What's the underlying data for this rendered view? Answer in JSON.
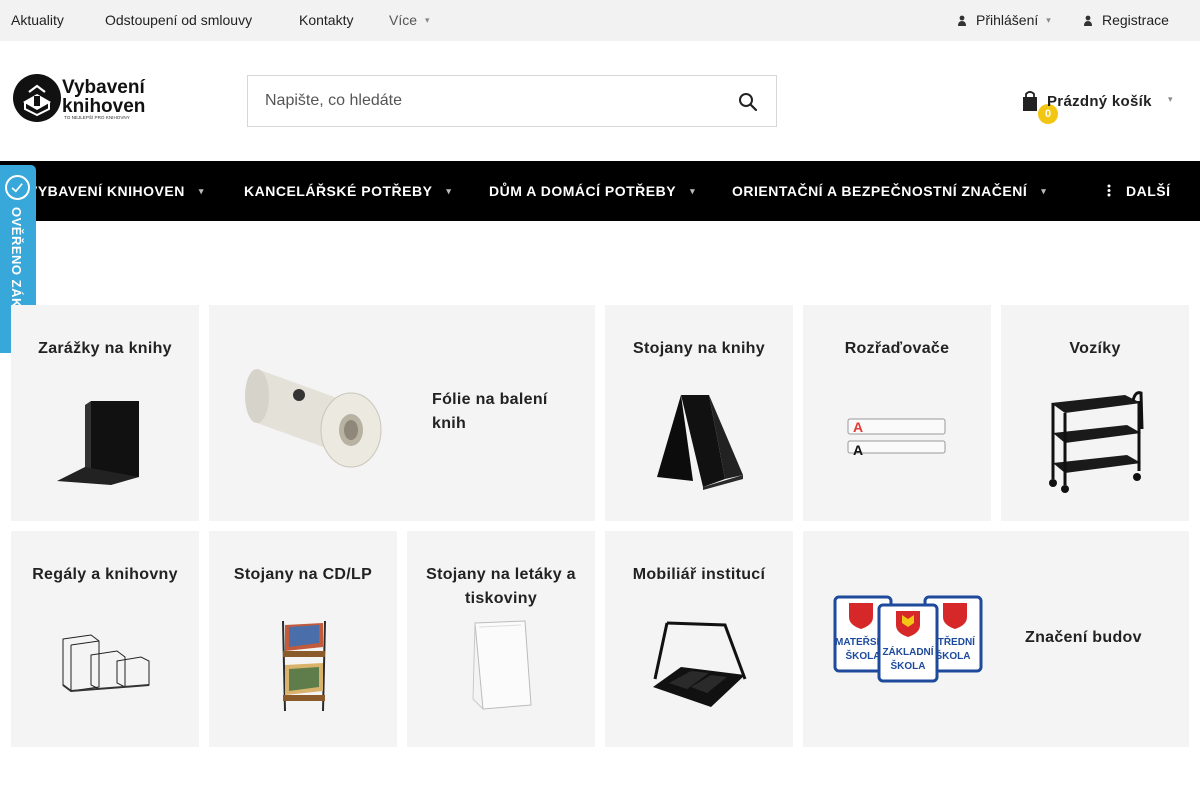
{
  "topbar": {
    "links": [
      "Aktuality",
      "Odstoupení od smlouvy",
      "Kontakty"
    ],
    "more": "Více",
    "login": "Přihlášení",
    "register": "Registrace"
  },
  "logo": {
    "line1": "Vybavení",
    "line2": "knihoven",
    "tagline": "TO NEJLEPŠÍ PRO KNIHOVNY"
  },
  "search": {
    "placeholder": "Napište, co hledáte"
  },
  "cart": {
    "count": "0",
    "label": "Prázdný košík"
  },
  "nav": {
    "items": [
      "VYBAVENÍ KNIHOVEN",
      "KANCELÁŘSKÉ POTŘEBY",
      "DŮM A DOMÁCÍ POTŘEBY",
      "ORIENTAČNÍ A BEZPEČNOSTNÍ ZNAČENÍ"
    ],
    "more": "DALŠÍ"
  },
  "verified": {
    "label": "OVĚŘENO ZÁKAZNÍKY"
  },
  "categories": [
    "Zarážky na knihy",
    "Fólie na balení knih",
    "Stojany na knihy",
    "Rozřaďovače",
    "Vozíky",
    "Regály a knihovny",
    "Stojany na CD/LP",
    "Stojany na letáky a tiskoviny",
    "Mobiliář institucí",
    "Značení budov"
  ],
  "signs": {
    "left": [
      "MATEŘSKÁ",
      "ŠKOLA"
    ],
    "center": [
      "ZÁKLADNÍ",
      "ŠKOLA"
    ],
    "right": [
      "STŘEDNÍ",
      "ŠKOLA"
    ]
  },
  "divider_letter": "A",
  "colors": {
    "nav_bg": "#000000",
    "topbar_bg": "#f2f2f2",
    "tile_bg": "#f4f4f4",
    "cart_badge": "#f3c614",
    "verified_badge": "#38a7d9"
  }
}
